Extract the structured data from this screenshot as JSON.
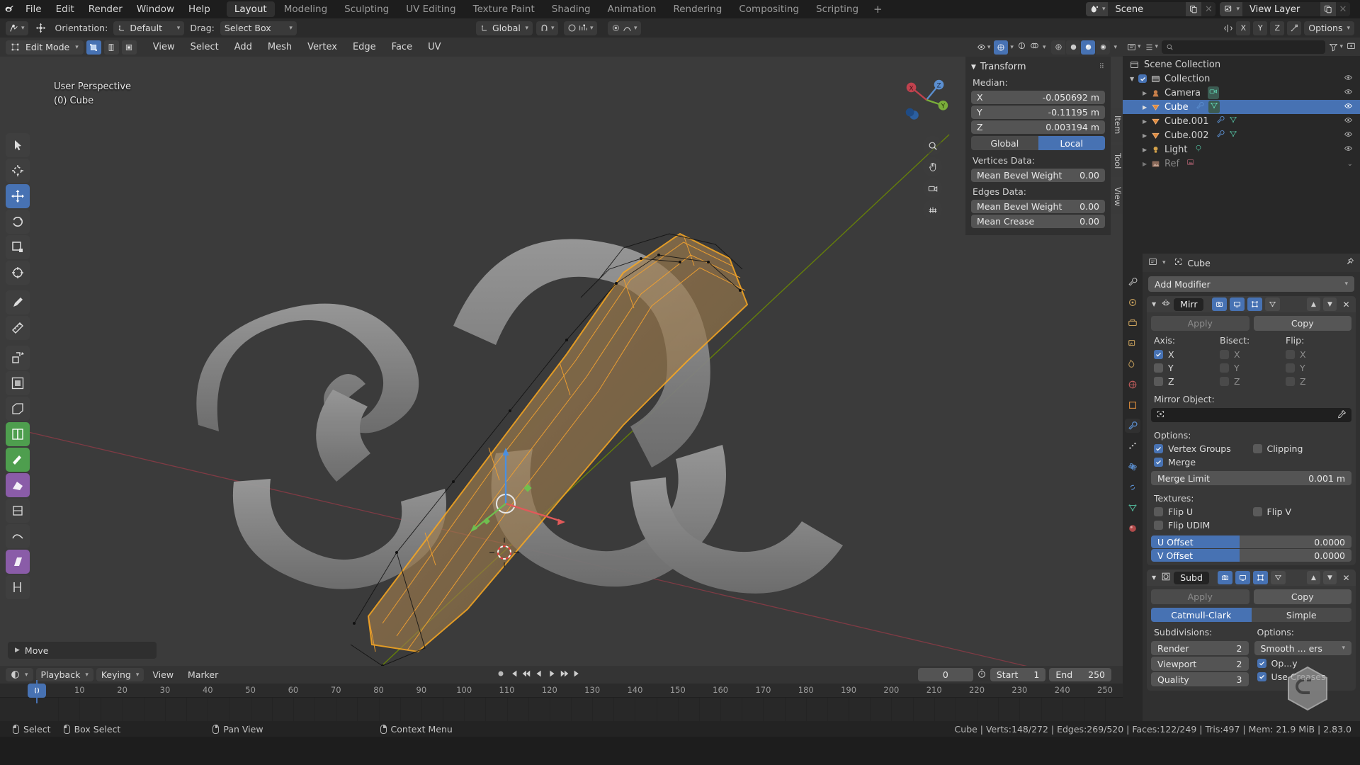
{
  "topbar": {
    "menus": [
      "File",
      "Edit",
      "Render",
      "Window",
      "Help"
    ],
    "workspaces": [
      {
        "label": "Layout",
        "active": true
      },
      {
        "label": "Modeling",
        "active": false
      },
      {
        "label": "Sculpting",
        "active": false
      },
      {
        "label": "UV Editing",
        "active": false
      },
      {
        "label": "Texture Paint",
        "active": false
      },
      {
        "label": "Shading",
        "active": false
      },
      {
        "label": "Animation",
        "active": false
      },
      {
        "label": "Rendering",
        "active": false
      },
      {
        "label": "Compositing",
        "active": false
      },
      {
        "label": "Scripting",
        "active": false
      }
    ],
    "add_workspace": "+",
    "scene_name": "Scene",
    "view_layer_name": "View Layer"
  },
  "tool_header": {
    "orientation_label": "Orientation:",
    "orientation_value": "Default",
    "drag_label": "Drag:",
    "drag_value": "Select Box",
    "transform_orientation": "Global",
    "axis_x": "X",
    "axis_y": "Y",
    "axis_z": "Z",
    "options_label": "Options"
  },
  "view_header": {
    "mode": "Edit Mode",
    "menus": [
      "View",
      "Select",
      "Add",
      "Mesh",
      "Vertex",
      "Edge",
      "Face",
      "UV"
    ]
  },
  "viewport": {
    "perspective_label": "User Perspective",
    "object_label": "(0) Cube",
    "operator_panel": "Move",
    "side_tabs": [
      "Item",
      "Tool",
      "View"
    ]
  },
  "transform_panel": {
    "title": "Transform",
    "median_label": "Median:",
    "median": [
      {
        "axis": "X",
        "value": "-0.050692 m"
      },
      {
        "axis": "Y",
        "value": "-0.11195 m"
      },
      {
        "axis": "Z",
        "value": "0.003194 m"
      }
    ],
    "space_global": "Global",
    "space_local": "Local",
    "space_active": "Local",
    "vertices_data_label": "Vertices Data:",
    "vertices_rows": [
      {
        "label": "Mean Bevel Weight",
        "value": "0.00"
      }
    ],
    "edges_data_label": "Edges Data:",
    "edges_rows": [
      {
        "label": "Mean Bevel Weight",
        "value": "0.00"
      },
      {
        "label": "Mean Crease",
        "value": "0.00"
      }
    ]
  },
  "outliner": {
    "root": "Scene Collection",
    "items": [
      {
        "label": "Collection",
        "indent": 1,
        "icon": "collection-icon",
        "selected": false,
        "checkbox": true,
        "arrow": "down",
        "eye": true
      },
      {
        "label": "Camera",
        "indent": 2,
        "icon": "camera-icon",
        "selected": false,
        "arrow": "right",
        "eye": true,
        "badges": [
          "camera-data-icon"
        ]
      },
      {
        "label": "Cube",
        "indent": 2,
        "icon": "mesh-icon",
        "selected": true,
        "arrow": "right",
        "eye": true,
        "badges": [
          "modifier-icon",
          "mesh-data-icon"
        ]
      },
      {
        "label": "Cube.001",
        "indent": 2,
        "icon": "mesh-icon",
        "selected": false,
        "arrow": "right",
        "eye": true,
        "badges": [
          "modifier-icon",
          "mesh-data-icon"
        ]
      },
      {
        "label": "Cube.002",
        "indent": 2,
        "icon": "mesh-icon",
        "selected": false,
        "arrow": "right",
        "eye": true,
        "badges": [
          "modifier-icon",
          "mesh-data-icon"
        ]
      },
      {
        "label": "Light",
        "indent": 2,
        "icon": "light-icon",
        "selected": false,
        "arrow": "right",
        "eye": true,
        "badges": [
          "light-data-icon"
        ]
      },
      {
        "label": "Ref",
        "indent": 2,
        "icon": "image-icon",
        "selected": false,
        "arrow": "right",
        "eye": false,
        "dim": true,
        "badges": [
          "image-data-icon"
        ]
      }
    ]
  },
  "properties": {
    "breadcrumb_object": "Cube",
    "add_modifier": "Add Modifier",
    "modifiers": [
      {
        "short_name": "Mirr",
        "type": "mirror",
        "apply": "Apply",
        "copy": "Copy",
        "axis_label": "Axis:",
        "bisect_label": "Bisect:",
        "flip_label": "Flip:",
        "axis": [
          {
            "label": "X",
            "checked": true
          },
          {
            "label": "Y",
            "checked": false
          },
          {
            "label": "Z",
            "checked": false
          }
        ],
        "bisect": [
          {
            "label": "X",
            "checked": false
          },
          {
            "label": "Y",
            "checked": false
          },
          {
            "label": "Z",
            "checked": false
          }
        ],
        "flip": [
          {
            "label": "X",
            "checked": false
          },
          {
            "label": "Y",
            "checked": false
          },
          {
            "label": "Z",
            "checked": false
          }
        ],
        "mirror_object_label": "Mirror Object:",
        "mirror_object_value": "",
        "options_label": "Options:",
        "vertex_groups": {
          "label": "Vertex Groups",
          "checked": true
        },
        "clipping": {
          "label": "Clipping",
          "checked": false
        },
        "merge": {
          "label": "Merge",
          "checked": true
        },
        "merge_limit_label": "Merge Limit",
        "merge_limit_value": "0.001 m",
        "textures_label": "Textures:",
        "flip_u": {
          "label": "Flip U",
          "checked": false
        },
        "flip_v": {
          "label": "Flip V",
          "checked": false
        },
        "flip_udim": {
          "label": "Flip UDIM",
          "checked": false
        },
        "u_offset_label": "U Offset",
        "u_offset_value": "0.0000",
        "v_offset_label": "V Offset",
        "v_offset_value": "0.0000"
      },
      {
        "short_name": "Subd",
        "type": "subsurf",
        "apply": "Apply",
        "copy": "Copy",
        "catmull": "Catmull-Clark",
        "simple": "Simple",
        "active_algorithm": "Catmull-Clark",
        "subdivisions_label": "Subdivisions:",
        "render_label": "Render",
        "render_value": "2",
        "viewport_label": "Viewport",
        "viewport_value": "2",
        "quality_label": "Quality",
        "quality_value": "3",
        "options_label": "Options:",
        "uv_smooth_value": "Smooth ... ers",
        "optimal_display": {
          "label": "Op...y",
          "checked": true
        },
        "use_creases": {
          "label": "Use Creases",
          "checked": true
        }
      }
    ]
  },
  "timeline": {
    "playback": "Playback",
    "keying": "Keying",
    "view": "View",
    "marker": "Marker",
    "current_frame": "0",
    "start_label": "Start",
    "start_value": "1",
    "end_label": "End",
    "end_value": "250",
    "ticks": [
      "0",
      "10",
      "20",
      "30",
      "40",
      "50",
      "60",
      "70",
      "80",
      "90",
      "100",
      "110",
      "120",
      "130",
      "140",
      "150",
      "160",
      "170",
      "180",
      "190",
      "200",
      "210",
      "220",
      "230",
      "240",
      "250"
    ]
  },
  "status_bar": {
    "hints": [
      {
        "icon": "mouse-left-icon",
        "label": "Select"
      },
      {
        "icon": "mouse-left-drag-icon",
        "label": "Box Select"
      },
      {
        "icon": "mouse-middle-icon",
        "label": "Pan View"
      },
      {
        "icon": "mouse-right-icon",
        "label": "Context Menu"
      }
    ],
    "stats": "Cube | Verts:148/272 | Edges:269/520 | Faces:122/249 | Tris:497 | Mem: 21.9 MiB | 2.83.0"
  },
  "colors": {
    "accent_blue": "#4772b3",
    "selection_orange": "#f5a623",
    "axis_x_red": "#cc4453",
    "axis_y_green": "#88b300",
    "bg_dark": "#1d1d1d",
    "bg_panel": "#303030",
    "viewport_bg": "#3b3b3b"
  }
}
